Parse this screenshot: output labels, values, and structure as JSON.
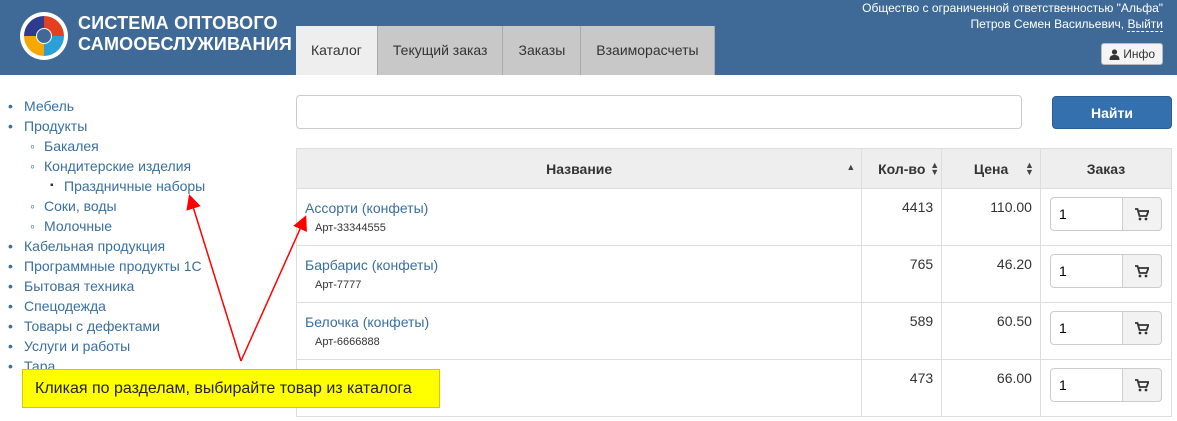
{
  "brand": {
    "line1": "СИСТЕМА ОПТОВОГО",
    "line2": "САМООБСЛУЖИВАНИЯ"
  },
  "tabs": [
    {
      "label": "Каталог",
      "active": true
    },
    {
      "label": "Текущий заказ",
      "active": false
    },
    {
      "label": "Заказы",
      "active": false
    },
    {
      "label": "Взаиморасчеты",
      "active": false
    }
  ],
  "account": {
    "company": "Общество с ограниченной ответственностью \"Альфа\"",
    "user": "Петров Семен Васильевич,",
    "logout": "Выйти",
    "info_label": "Инфо"
  },
  "sidebar": {
    "items": [
      {
        "label": "Мебель"
      },
      {
        "label": "Продукты"
      },
      {
        "label": "Бакалея"
      },
      {
        "label": "Кондитерские изделия"
      },
      {
        "label": "Праздничные наборы"
      },
      {
        "label": "Соки, воды"
      },
      {
        "label": "Молочные"
      },
      {
        "label": "Кабельная продукция"
      },
      {
        "label": "Программные продукты 1С"
      },
      {
        "label": "Бытовая техника"
      },
      {
        "label": "Спецодежда"
      },
      {
        "label": "Товары с дефектами"
      },
      {
        "label": "Услуги и работы"
      },
      {
        "label": "Тара"
      }
    ]
  },
  "search": {
    "value": "",
    "button_label": "Найти"
  },
  "table": {
    "headers": {
      "name": "Название",
      "qty": "Кол-во",
      "price": "Цена",
      "order": "Заказ"
    },
    "rows": [
      {
        "name": "Ассорти (конфеты)",
        "art": "Арт-33344555",
        "qty": "4413",
        "price": "110.00",
        "order_qty": "1"
      },
      {
        "name": "Барбарис (конфеты)",
        "art": "Арт-7777",
        "qty": "765",
        "price": "46.20",
        "order_qty": "1"
      },
      {
        "name": "Белочка (конфеты)",
        "art": "Арт-6666888",
        "qty": "589",
        "price": "60.50",
        "order_qty": "1"
      },
      {
        "name": "",
        "art": "",
        "qty": "473",
        "price": "66.00",
        "order_qty": "1"
      }
    ]
  },
  "tooltip": "Кликая по разделам, выбирайте товар из каталога",
  "colors": {
    "header_bg": "#3f6a97",
    "link": "#3a6f9f",
    "primary_button": "#3470ad",
    "tooltip_bg": "#ffff00",
    "arrow": "#ff0000"
  },
  "icons": {
    "logo": "logo-icon",
    "user": "user-icon",
    "cart": "cart-icon",
    "sort": "sort-icon"
  }
}
